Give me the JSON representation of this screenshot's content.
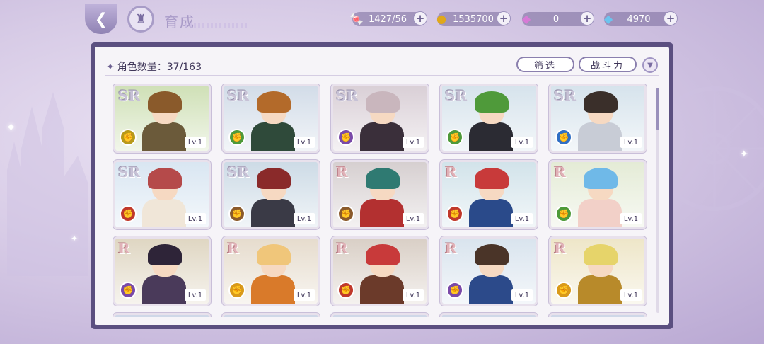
{
  "header": {
    "title": "育成"
  },
  "resources": [
    {
      "name": "stamina",
      "icon": "candy-icon",
      "value": "1427/56"
    },
    {
      "name": "gold",
      "icon": "coin-icon",
      "value": "1535700"
    },
    {
      "name": "gem-pink",
      "icon": "pink-diamond-icon",
      "value": "0"
    },
    {
      "name": "gem-blue",
      "icon": "blue-diamond-icon",
      "value": "4970"
    }
  ],
  "roster": {
    "count_label": "角色数量：37/163",
    "filter_label": "筛选",
    "sort_label": "战斗力"
  },
  "cards": [
    {
      "rarity": "SR",
      "level": "Lv.1",
      "element_color": "#b79a1a",
      "hair": "#8a5a2b",
      "outfit": "#6b5a3a",
      "sky": "#cfe0b6"
    },
    {
      "rarity": "SR",
      "level": "Lv.1",
      "element_color": "#4e9a3a",
      "hair": "#b36a2a",
      "outfit": "#2f4a3a",
      "sky": "#d2dce8"
    },
    {
      "rarity": "SR",
      "level": "Lv.1",
      "element_color": "#7a4aa8",
      "hair": "#c9b6bd",
      "outfit": "#3a2f3a",
      "sky": "#d9cfd6"
    },
    {
      "rarity": "SR",
      "level": "Lv.1",
      "element_color": "#4e9a3a",
      "hair": "#4f9a3a",
      "outfit": "#2b2b33",
      "sky": "#d6e3ec"
    },
    {
      "rarity": "SR",
      "level": "Lv.1",
      "element_color": "#2f6fc4",
      "hair": "#3a2f2a",
      "outfit": "#c8ccd6",
      "sky": "#d6e3ec"
    },
    {
      "rarity": "SR",
      "level": "Lv.1",
      "element_color": "#c0392b",
      "hair": "#b54a4a",
      "outfit": "#f0e6d8",
      "sky": "#d9e6f2"
    },
    {
      "rarity": "SR",
      "level": "Lv.1",
      "element_color": "#8a5a2b",
      "hair": "#8a2a2a",
      "outfit": "#3a3a46",
      "sky": "#cddbe6"
    },
    {
      "rarity": "R",
      "level": "Lv.1",
      "element_color": "#8a5a2b",
      "hair": "#2f7a72",
      "outfit": "#b33030",
      "sky": "#d6cfd0"
    },
    {
      "rarity": "R",
      "level": "Lv.1",
      "element_color": "#c0392b",
      "hair": "#c83a3a",
      "outfit": "#2a4a8a",
      "sky": "#d2e3ea"
    },
    {
      "rarity": "R",
      "level": "Lv.1",
      "element_color": "#4e9a3a",
      "hair": "#6fb9e8",
      "outfit": "#f2d0c8",
      "sky": "#e4ebd6"
    },
    {
      "rarity": "R",
      "level": "Lv.1",
      "element_color": "#7a4aa8",
      "hair": "#2e2438",
      "outfit": "#4a3a5a",
      "sky": "#dfd6c2"
    },
    {
      "rarity": "R",
      "level": "Lv.1",
      "element_color": "#d99a1a",
      "hair": "#f0c67a",
      "outfit": "#d97a2a",
      "sky": "#e6dccd"
    },
    {
      "rarity": "R",
      "level": "Lv.1",
      "element_color": "#c0392b",
      "hair": "#c83a3a",
      "outfit": "#6b3a2a",
      "sky": "#d9cfc6"
    },
    {
      "rarity": "R",
      "level": "Lv.1",
      "element_color": "#7a4aa8",
      "hair": "#4a3428",
      "outfit": "#2c4a8a",
      "sky": "#d9e4ee"
    },
    {
      "rarity": "R",
      "level": "Lv.1",
      "element_color": "#d99a1a",
      "hair": "#e6d46a",
      "outfit": "#b88a2a",
      "sky": "#eee6c8"
    }
  ]
}
